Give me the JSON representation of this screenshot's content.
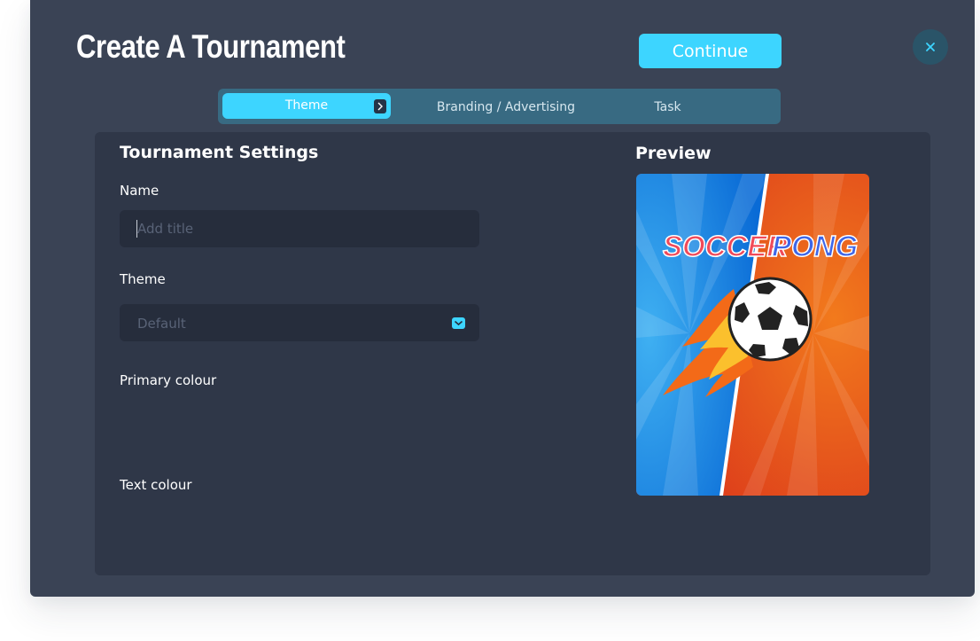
{
  "dialog": {
    "title": "Create A Tournament",
    "continue_label": "Continue",
    "close_icon": "close-icon"
  },
  "tabs": [
    {
      "label": "Theme",
      "active": true
    },
    {
      "label": "Branding / Advertising",
      "active": false
    },
    {
      "label": "Task",
      "active": false
    }
  ],
  "settings": {
    "heading": "Tournament Settings",
    "name_label": "Name",
    "name_placeholder": "Add title",
    "name_value": "",
    "theme_label": "Theme",
    "theme_value": "Default",
    "primary_colour_label": "Primary colour",
    "text_colour_label": "Text colour"
  },
  "preview": {
    "heading": "Preview",
    "game_title_left": "SOCCER",
    "game_title_right": "PONG"
  },
  "colors": {
    "accent": "#3dd5ff",
    "modal_bg": "#3a4355",
    "panel_bg": "#2f3748",
    "input_bg": "#262d3c",
    "tab_bar": "#386a82"
  }
}
